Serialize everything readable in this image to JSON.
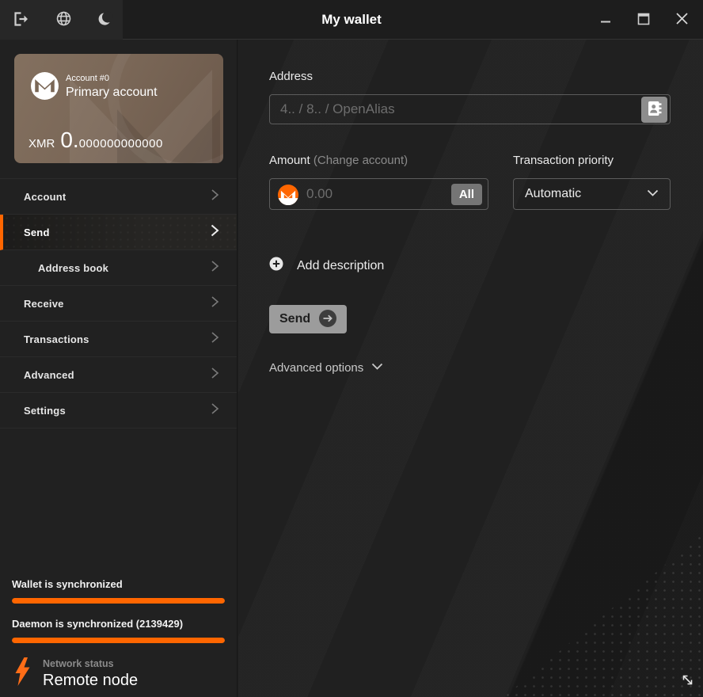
{
  "titlebar": {
    "title": "My wallet",
    "icons": {
      "left": [
        "logout-icon",
        "globe-icon",
        "moon-icon"
      ],
      "right": [
        "minimize-icon",
        "maximize-icon",
        "close-icon"
      ]
    }
  },
  "sidebar": {
    "card": {
      "account_label": "Account #0",
      "account_name": "Primary account",
      "currency": "XMR",
      "balance_whole": "0.",
      "balance_decimals": "000000000000"
    },
    "menu": [
      {
        "label": "Account"
      },
      {
        "label": "Send"
      },
      {
        "label": "Address book"
      },
      {
        "label": "Receive"
      },
      {
        "label": "Transactions"
      },
      {
        "label": "Advanced"
      },
      {
        "label": "Settings"
      }
    ],
    "status": {
      "wallet_sync": "Wallet is synchronized",
      "wallet_progress_pct": 100,
      "daemon_sync": "Daemon is synchronized (2139429)",
      "daemon_progress_pct": 100,
      "network_label": "Network status",
      "network_value": "Remote node",
      "network_icon": "lightning-bolt-icon"
    }
  },
  "main": {
    "address": {
      "label": "Address",
      "placeholder": "4.. / 8.. / OpenAlias",
      "action_icon": "address-book-icon"
    },
    "amount": {
      "label": "Amount",
      "hint": "(Change account)",
      "placeholder": "0.00",
      "all_label": "All",
      "currency_icon": "monero-icon"
    },
    "priority": {
      "label": "Transaction priority",
      "value": "Automatic"
    },
    "description_label": "Add description",
    "description_icon": "plus-circle-icon",
    "send_label": "Send",
    "send_icon": "arrow-right-circle-icon",
    "advanced_label": "Advanced options",
    "resize_icon": "resize-diagonal-icon"
  },
  "colors": {
    "accent": "#ff6600",
    "card_gradient": [
      "#83705f",
      "#6b584a"
    ],
    "progress": "#ff6600"
  }
}
